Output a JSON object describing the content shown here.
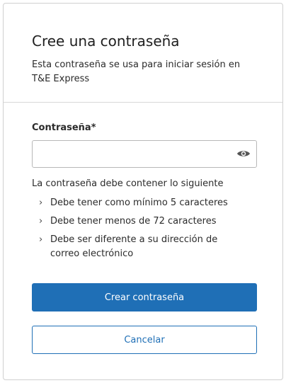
{
  "header": {
    "title": "Cree una contraseña",
    "subtitle": "Esta contraseña se usa para iniciar sesión en T&E Express"
  },
  "form": {
    "password_label": "Contraseña*",
    "password_value": "",
    "eye_icon": "eye-icon"
  },
  "requirements": {
    "intro": "La contraseña debe contener lo siguiente",
    "items": [
      "Debe tener como mínimo 5 caracteres",
      "Debe tener menos de 72 caracteres",
      "Debe ser diferente a su dirección de correo electrónico"
    ],
    "bullet_icon": "chevron-right-icon"
  },
  "actions": {
    "create_label": "Crear contraseña",
    "cancel_label": "Cancelar"
  },
  "colors": {
    "primary": "#1f6fb6",
    "border": "#d0d0d0",
    "text": "#2b2b2b"
  }
}
